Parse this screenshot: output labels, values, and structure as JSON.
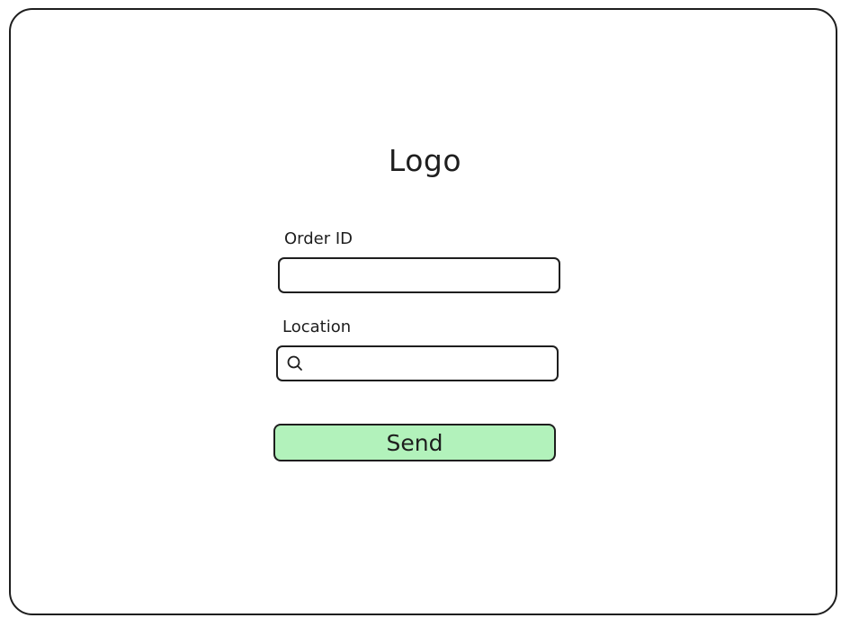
{
  "app": {
    "logo_text": "Logo"
  },
  "form": {
    "order_id": {
      "label": "Order ID",
      "value": "",
      "placeholder": ""
    },
    "location": {
      "label": "Location",
      "value": "",
      "placeholder": "",
      "icon": "search-icon"
    },
    "send_label": "Send"
  },
  "colors": {
    "stroke": "#1e1e1e",
    "send_button_fill": "#b2f2bb",
    "background": "#ffffff"
  }
}
